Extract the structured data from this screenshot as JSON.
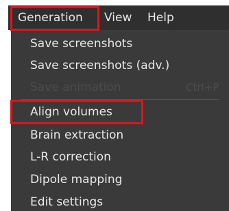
{
  "menubar": {
    "items": [
      {
        "label": "Generation"
      },
      {
        "label": "View"
      },
      {
        "label": "Help"
      }
    ]
  },
  "dropdown": {
    "items": [
      {
        "label": "Save screenshots",
        "enabled": true
      },
      {
        "label": "Save screenshots (adv.)",
        "enabled": true
      },
      {
        "label": "Save animation",
        "enabled": false,
        "shortcut": "Ctrl+P"
      },
      {
        "label": "Align volumes",
        "enabled": true
      },
      {
        "label": "Brain extraction",
        "enabled": true
      },
      {
        "label": "L-R correction",
        "enabled": true
      },
      {
        "label": "Dipole mapping",
        "enabled": true
      },
      {
        "label": "Edit settings",
        "enabled": true
      }
    ]
  },
  "colors": {
    "menubar_bg": "#2f2f2f",
    "menu_bg": "#3a3a3a",
    "text": "#e8e8e8",
    "disabled_text": "#4c4c4c",
    "annotation_red": "#e0141c"
  }
}
